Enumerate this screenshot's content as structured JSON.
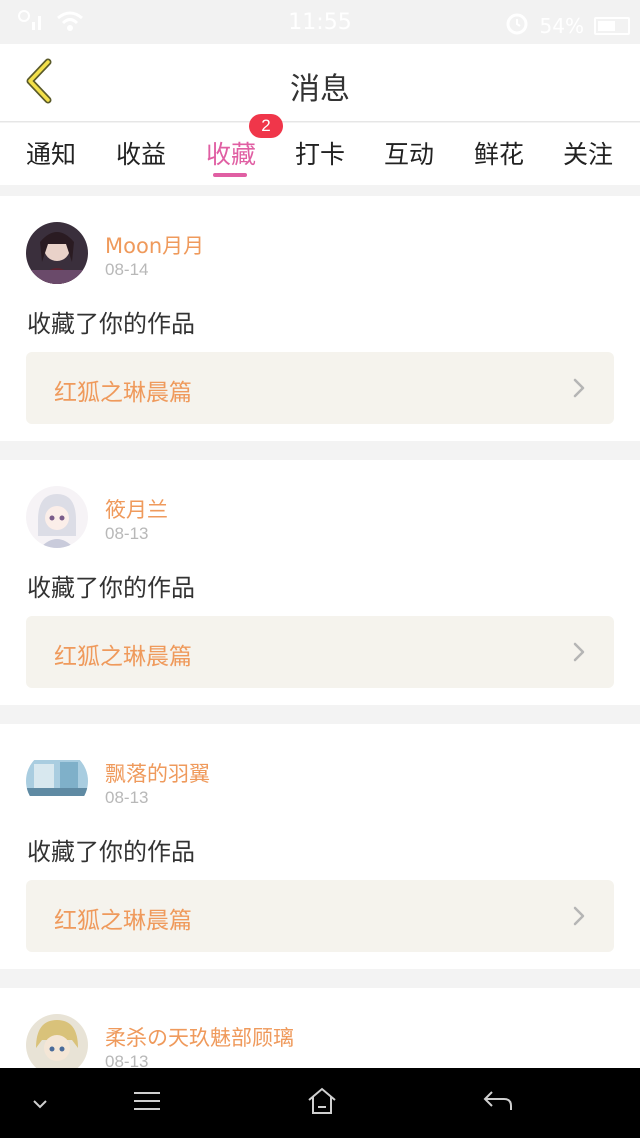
{
  "status": {
    "time": "11:55",
    "battery": "54%"
  },
  "header": {
    "title": "消息"
  },
  "tabs": [
    {
      "label": "通知"
    },
    {
      "label": "收益"
    },
    {
      "label": "收藏",
      "badge": "2",
      "active": true
    },
    {
      "label": "打卡"
    },
    {
      "label": "互动"
    },
    {
      "label": "鲜花"
    },
    {
      "label": "关注"
    }
  ],
  "messages": [
    {
      "username": "Moon月月",
      "date": "08-14",
      "action": "收藏了你的作品",
      "work_title": "红狐之琳晨篇"
    },
    {
      "username": "筱月兰",
      "date": "08-13",
      "action": "收藏了你的作品",
      "work_title": "红狐之琳晨篇"
    },
    {
      "username": "飘落的羽翼",
      "date": "08-13",
      "action": "收藏了你的作品",
      "work_title": "红狐之琳晨篇"
    },
    {
      "username": "柔杀の天玖魅部顾璃",
      "date": "08-13"
    }
  ],
  "colors": {
    "accent": "#e05fa3",
    "username": "#ef9a5c",
    "badge": "#f0364a",
    "work_box_bg": "#f5f3ed"
  },
  "icons": {
    "back": "chevron-left-icon",
    "work_link": "chevron-right-icon"
  }
}
